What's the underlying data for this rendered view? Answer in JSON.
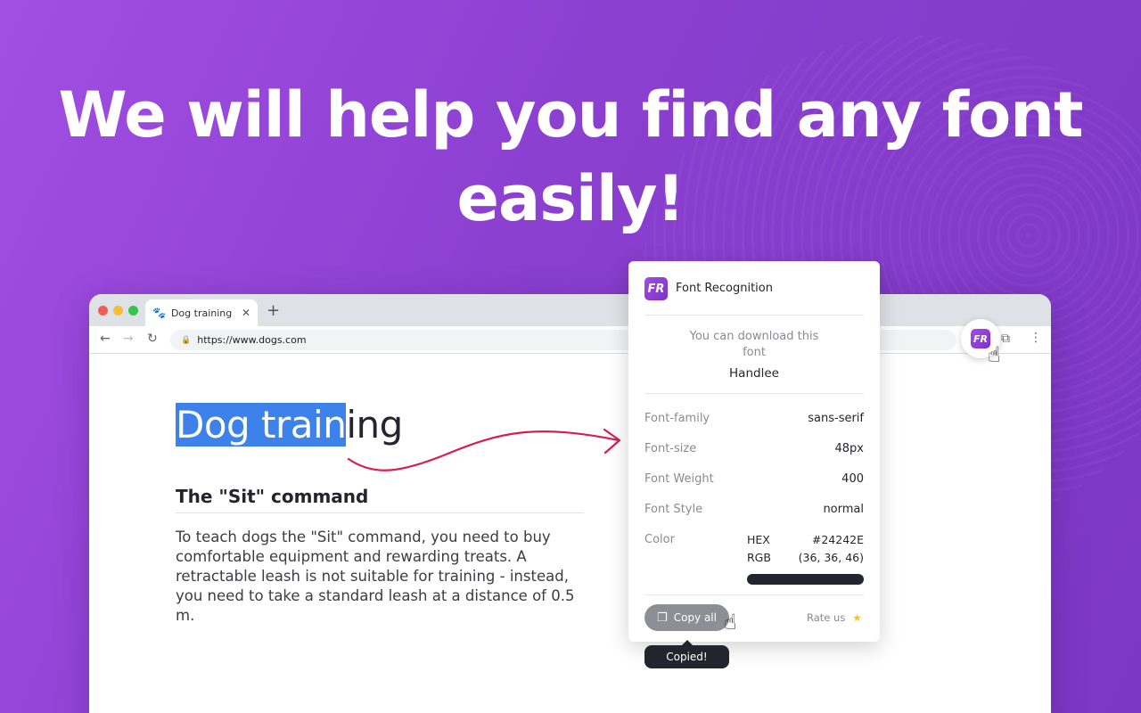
{
  "headline": "We will help you find any font easily!",
  "browser": {
    "tab_title": "Dog training",
    "url": "https://www.dogs.com"
  },
  "page": {
    "heading_selected": "Dog train",
    "heading_rest": "ing",
    "section_title": "The \"Sit\" command",
    "section_body": "To teach dogs the \"Sit\" command, you need to buy comfortable equipment and rewarding treats. A retractable leash is not suitable for training - instead, you need to take a standard leash at a distance of 0.5 m."
  },
  "popup": {
    "title": "Font Recognition",
    "logo_text": "FR",
    "download_text": "You can download this font",
    "font_name": "Handlee",
    "properties": [
      {
        "label": "Font-family",
        "value": "sans-serif"
      },
      {
        "label": "Font-size",
        "value": "48px"
      },
      {
        "label": "Font Weight",
        "value": "400"
      },
      {
        "label": "Font Style",
        "value": "normal"
      }
    ],
    "color_label": "Color",
    "hex_label": "HEX",
    "hex_value": "#24242E",
    "rgb_label": "RGB",
    "rgb_value": "(36, 36, 46)",
    "copy_label": "Copy all",
    "rate_label": "Rate us",
    "tooltip": "Copied!"
  },
  "colors": {
    "accent_purple": "#8a3fcf",
    "selection_blue": "#3d82ea",
    "arrow_red": "#d81e4d",
    "text_color": "#24242E"
  },
  "icons": [
    "paw-icon",
    "close-icon",
    "plus-icon",
    "back-icon",
    "forward-icon",
    "reload-icon",
    "lock-icon",
    "extension-puzzle-icon",
    "menu-dots-icon",
    "font-recognition-logo",
    "hand-cursor-icon",
    "copy-icon",
    "star-icon"
  ]
}
